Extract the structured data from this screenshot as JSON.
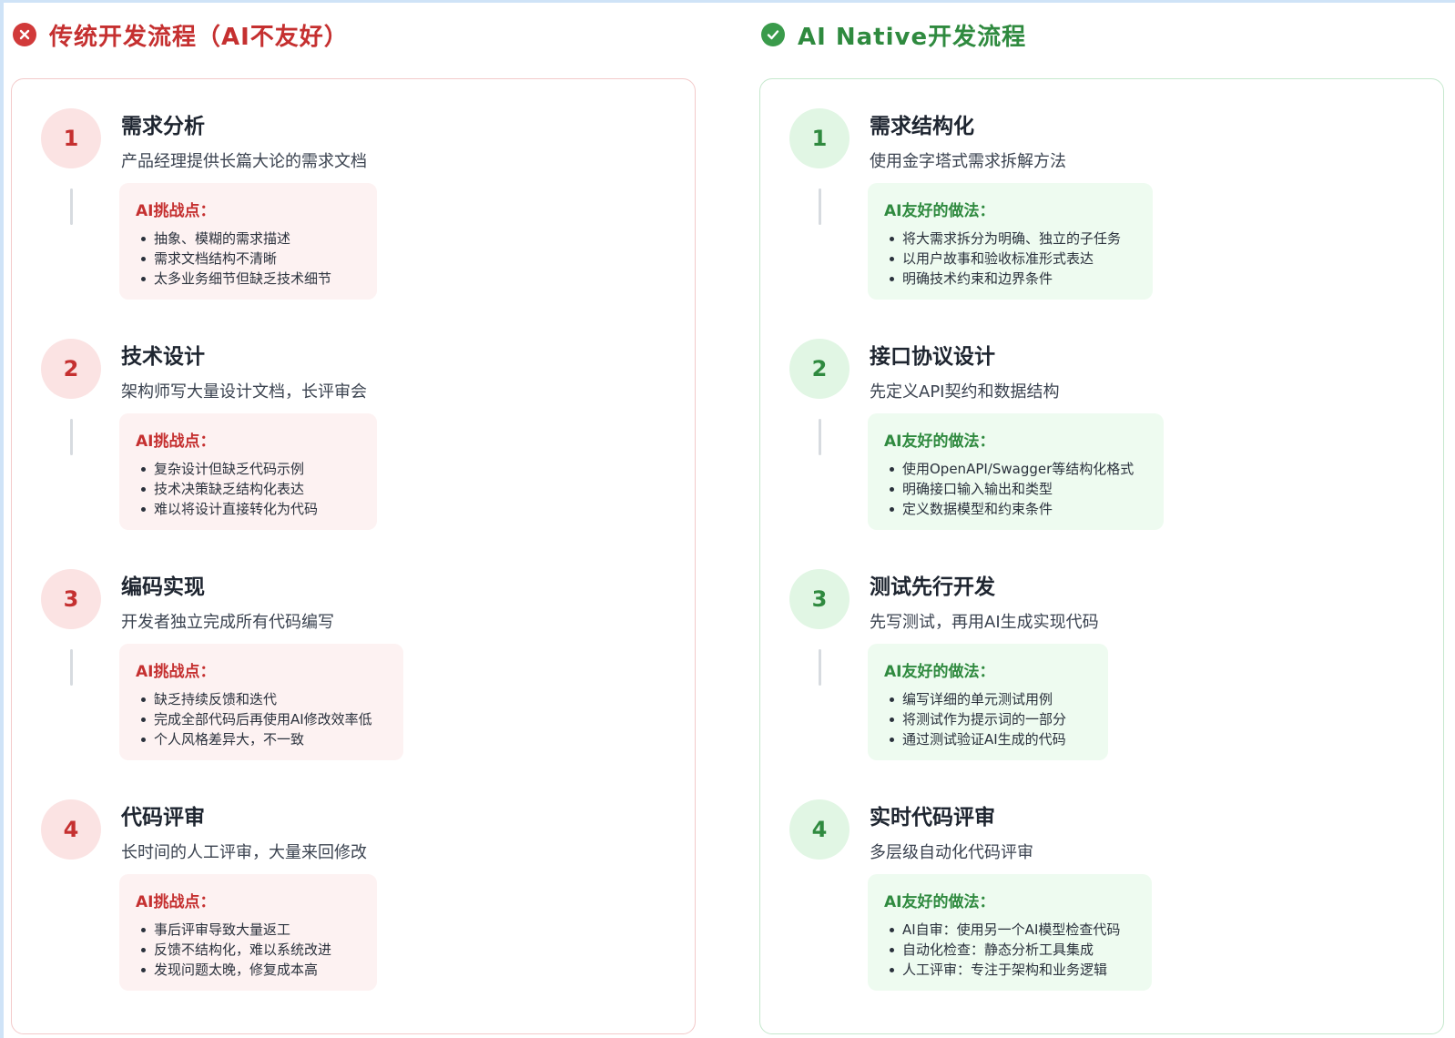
{
  "left": {
    "title": "传统开发流程（AI不友好）",
    "icon": "x-circle-icon",
    "accent": "#c53030",
    "box_label": "AI挑战点：",
    "steps": [
      {
        "num": "1",
        "title": "需求分析",
        "desc": "产品经理提供长篇大论的需求文档",
        "points": [
          "抽象、模糊的需求描述",
          "需求文档结构不清晰",
          "太多业务细节但缺乏技术细节"
        ]
      },
      {
        "num": "2",
        "title": "技术设计",
        "desc": "架构师写大量设计文档，长评审会",
        "points": [
          "复杂设计但缺乏代码示例",
          "技术决策缺乏结构化表达",
          "难以将设计直接转化为代码"
        ]
      },
      {
        "num": "3",
        "title": "编码实现",
        "desc": "开发者独立完成所有代码编写",
        "points": [
          "缺乏持续反馈和迭代",
          "完成全部代码后再使用AI修改效率低",
          "个人风格差异大，不一致"
        ]
      },
      {
        "num": "4",
        "title": "代码评审",
        "desc": "长时间的人工评审，大量来回修改",
        "points": [
          "事后评审导致大量返工",
          "反馈不结构化，难以系统改进",
          "发现问题太晚，修复成本高"
        ]
      }
    ]
  },
  "right": {
    "title": "AI Native开发流程",
    "icon": "check-circle-icon",
    "accent": "#2f8a3f",
    "box_label": "AI友好的做法：",
    "steps": [
      {
        "num": "1",
        "title": "需求结构化",
        "desc": "使用金字塔式需求拆解方法",
        "points": [
          "将大需求拆分为明确、独立的子任务",
          "以用户故事和验收标准形式表达",
          "明确技术约束和边界条件"
        ]
      },
      {
        "num": "2",
        "title": "接口协议设计",
        "desc": "先定义API契约和数据结构",
        "points": [
          "使用OpenAPI/Swagger等结构化格式",
          "明确接口输入输出和类型",
          "定义数据模型和约束条件"
        ]
      },
      {
        "num": "3",
        "title": "测试先行开发",
        "desc": "先写测试，再用AI生成实现代码",
        "points": [
          "编写详细的单元测试用例",
          "将测试作为提示词的一部分",
          "通过测试验证AI生成的代码"
        ]
      },
      {
        "num": "4",
        "title": "实时代码评审",
        "desc": "多层级自动化代码评审",
        "points": [
          "AI自审：使用另一个AI模型检查代码",
          "自动化检查：静态分析工具集成",
          "人工评审：专注于架构和业务逻辑"
        ]
      }
    ]
  }
}
